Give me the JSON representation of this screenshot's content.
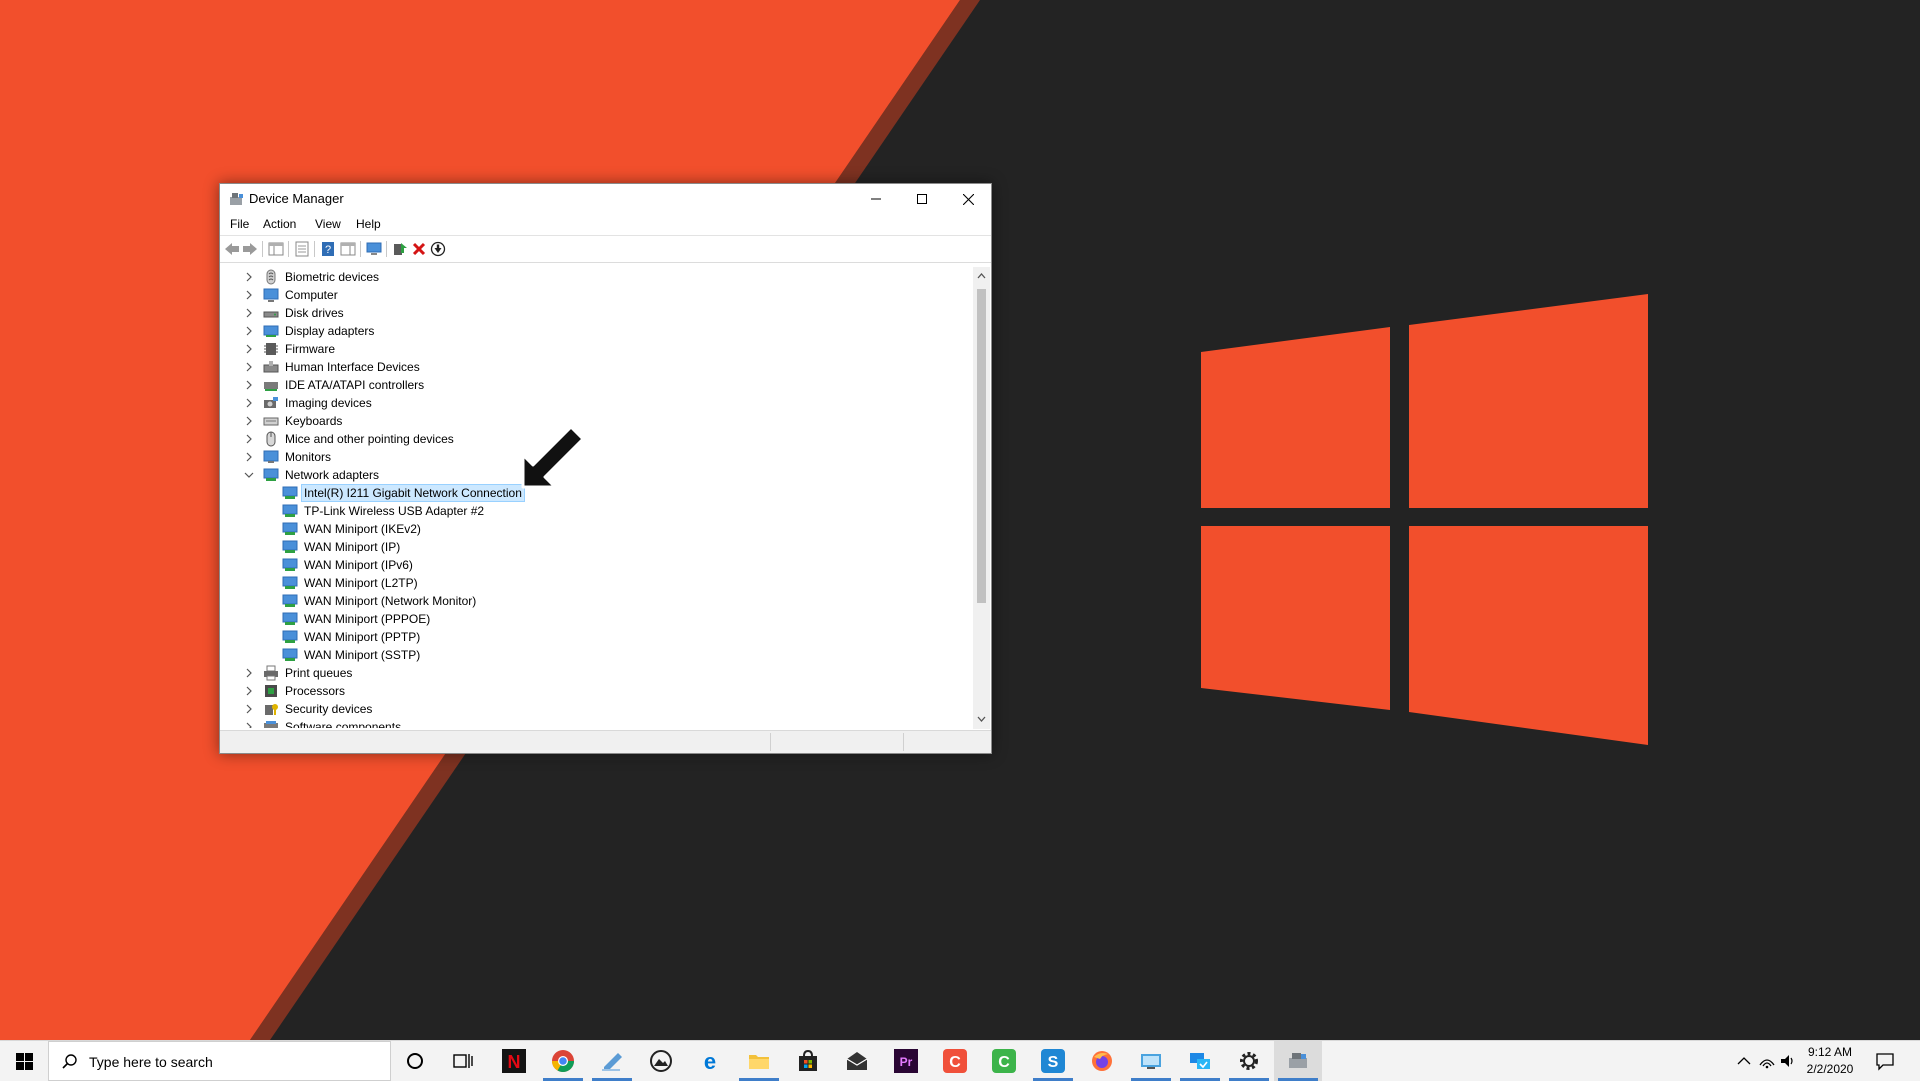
{
  "window": {
    "title": "Device Manager",
    "menu": [
      "File",
      "Action",
      "View",
      "Help"
    ]
  },
  "tree": {
    "categories_before": [
      {
        "label": "Biometric devices",
        "icon": "fingerprint-icon"
      },
      {
        "label": "Computer",
        "icon": "computer-icon"
      },
      {
        "label": "Disk drives",
        "icon": "disk-drive-icon"
      },
      {
        "label": "Display adapters",
        "icon": "display-adapter-icon"
      },
      {
        "label": "Firmware",
        "icon": "firmware-icon"
      },
      {
        "label": "Human Interface Devices",
        "icon": "hid-icon"
      },
      {
        "label": "IDE ATA/ATAPI controllers",
        "icon": "ide-controller-icon"
      },
      {
        "label": "Imaging devices",
        "icon": "camera-icon"
      },
      {
        "label": "Keyboards",
        "icon": "keyboard-icon"
      },
      {
        "label": "Mice and other pointing devices",
        "icon": "mouse-icon"
      },
      {
        "label": "Monitors",
        "icon": "monitor-icon"
      }
    ],
    "expanded_category": {
      "label": "Network adapters",
      "icon": "network-adapter-icon"
    },
    "network_adapters": [
      "Intel(R) I211 Gigabit Network Connection",
      "TP-Link Wireless USB Adapter #2",
      "WAN Miniport (IKEv2)",
      "WAN Miniport (IP)",
      "WAN Miniport (IPv6)",
      "WAN Miniport (L2TP)",
      "WAN Miniport (Network Monitor)",
      "WAN Miniport (PPPOE)",
      "WAN Miniport (PPTP)",
      "WAN Miniport (SSTP)"
    ],
    "selected_item": "Intel(R) I211 Gigabit Network Connection",
    "categories_after": [
      {
        "label": "Print queues",
        "icon": "printer-icon"
      },
      {
        "label": "Processors",
        "icon": "processor-icon"
      },
      {
        "label": "Security devices",
        "icon": "security-device-icon"
      },
      {
        "label": "Software components",
        "icon": "software-component-icon"
      }
    ]
  },
  "taskbar": {
    "search_placeholder": "Type here to search",
    "apps": [
      "cortana-icon",
      "task-view-icon",
      "netflix-icon",
      "chrome-icon",
      "notepad-icon",
      "photos-icon",
      "edge-icon",
      "file-explorer-icon",
      "store-icon",
      "mail-icon",
      "premiere-icon",
      "camtasia-icon",
      "camtasia-green-icon",
      "snagit-icon",
      "firefox-icon",
      "remote-desktop-icon",
      "network-share-icon",
      "settings-icon",
      "device-manager-icon"
    ],
    "clock_time": "9:12 AM",
    "clock_date": "2/2/2020"
  },
  "colors": {
    "wallpaper_orange": "#f24f2c",
    "wallpaper_dark": "#232323",
    "logo_orange": "#f24f2c",
    "selection_bg": "#cce8ff",
    "taskbar_bg": "#f3f3f3"
  }
}
